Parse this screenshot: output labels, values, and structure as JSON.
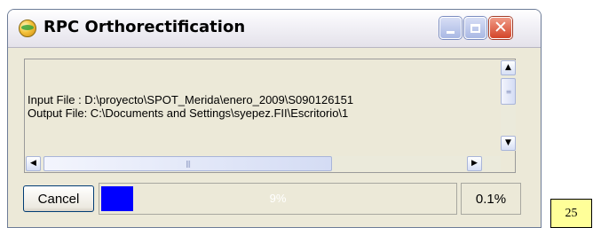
{
  "window": {
    "title": "RPC Orthorectification",
    "icon": "globe-icon",
    "controls": {
      "minimize": "minimize-icon",
      "maximize": "maximize-icon",
      "close": "close-icon"
    }
  },
  "log": {
    "lines": [
      "Input File : D:\\proyecto\\SPOT_Merida\\enero_2009\\S090126151",
      "Output File: C:\\Documents and Settings\\syepez.FII\\Escritorio\\1"
    ]
  },
  "status": {
    "cancel_label": "Cancel",
    "progress_fraction": 0.09,
    "progress_text": "9%",
    "percent_text": "0.1%",
    "fill_color": "#0000ff"
  },
  "badge": {
    "number": "25"
  }
}
